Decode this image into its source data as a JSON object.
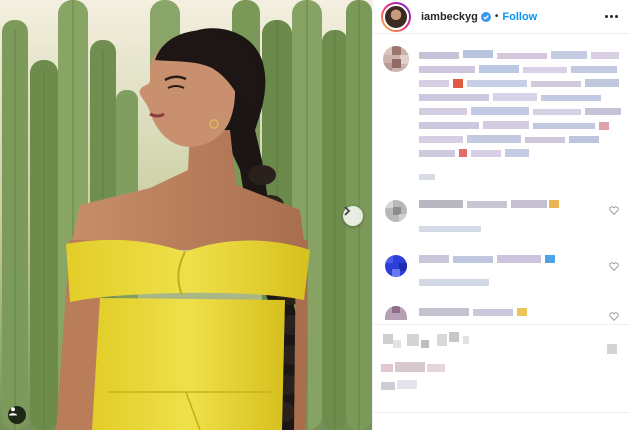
{
  "post": {
    "username": "iambeckyg",
    "separator": "•",
    "follow_label": "Follow",
    "verified": true
  },
  "icons": {
    "verified": "verified-badge-icon",
    "more": "more-options-icon",
    "next": "chevron-right-icon",
    "tag": "user-tag-icon",
    "like": "heart-icon"
  },
  "colors": {
    "accent": "#0095f6",
    "dress": "#e8d431",
    "cactus": "#6f8f4e"
  }
}
